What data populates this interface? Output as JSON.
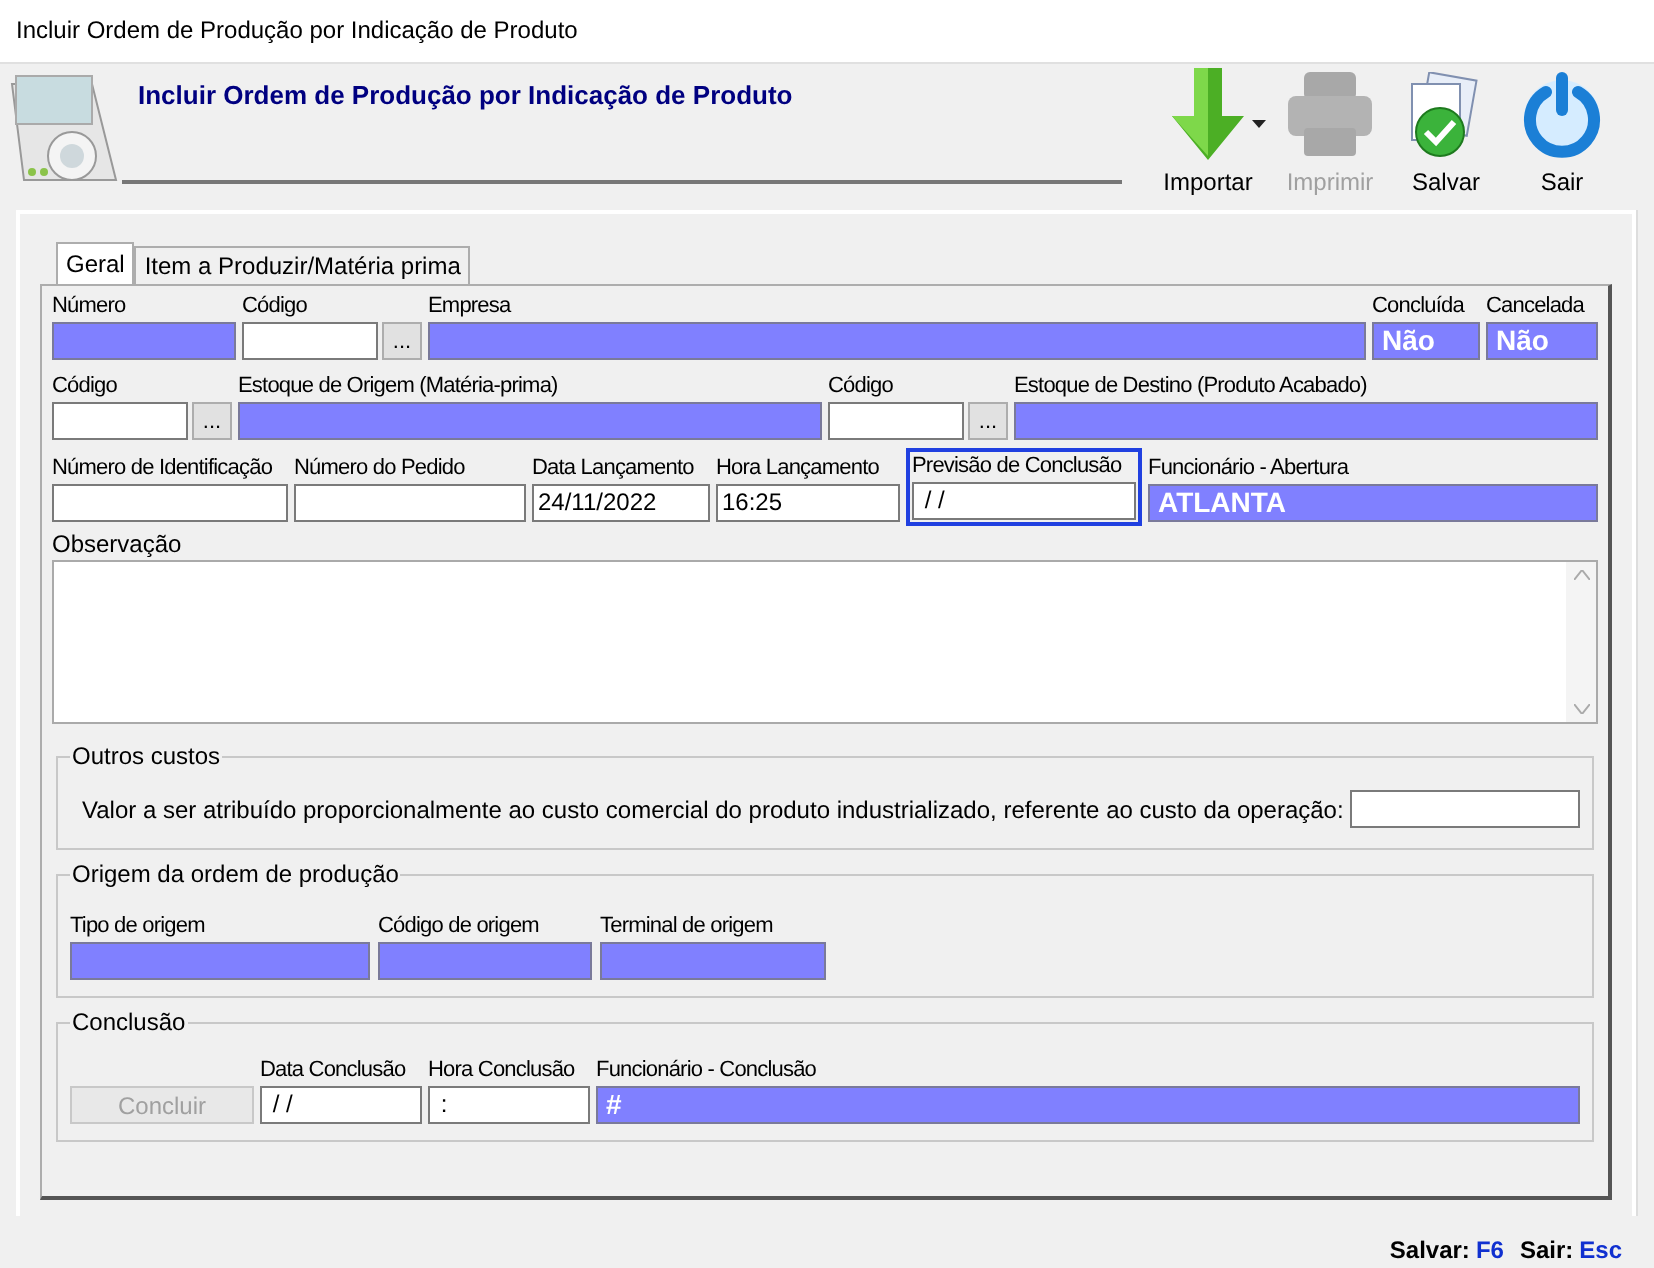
{
  "window": {
    "title": "Incluir Ordem de Produção por Indicação de Produto"
  },
  "header": {
    "title": "Incluir Ordem de Produção por Indicação de Produto"
  },
  "toolbar": [
    {
      "kind": "import",
      "label": "Importar",
      "disabled": false,
      "dropdown": true
    },
    {
      "kind": "print",
      "label": "Imprimir",
      "disabled": true,
      "dropdown": false
    },
    {
      "kind": "save",
      "label": "Salvar",
      "disabled": false,
      "dropdown": false
    },
    {
      "kind": "exit",
      "label": "Sair",
      "disabled": false,
      "dropdown": false
    }
  ],
  "tabs": [
    {
      "label": "Geral",
      "selected": true
    },
    {
      "label": "Item a Produzir/Matéria prima",
      "selected": false
    }
  ],
  "field_rows": [
    [
      {
        "label": "Número",
        "kind": "readonly"
      },
      {
        "label": "Código",
        "kind": "picker",
        "button": "..."
      },
      {
        "label": "Empresa",
        "kind": "readonly"
      },
      {
        "label": "Concluída",
        "kind": "readonly",
        "value": "Não"
      },
      {
        "label": "Cancelada",
        "kind": "readonly",
        "value": "Não"
      }
    ],
    [
      {
        "label": "Código",
        "kind": "picker",
        "button": "..."
      },
      {
        "label": "Estoque de Origem (Matéria-prima)",
        "kind": "readonly"
      },
      {
        "label": "Código",
        "kind": "picker",
        "button": "..."
      },
      {
        "label": "Estoque de Destino (Produto Acabado)",
        "kind": "readonly"
      }
    ],
    [
      {
        "label": "Número de Identificação",
        "kind": "input",
        "focused": false
      },
      {
        "label": "Número do Pedido",
        "kind": "input",
        "focused": false
      },
      {
        "label": "Data Lançamento",
        "kind": "input",
        "value": "24/11/2022",
        "focused": false
      },
      {
        "label": "Hora Lançamento",
        "kind": "input",
        "value": "16:25",
        "focused": false
      },
      {
        "label": "Previsão de Conclusão",
        "kind": "input",
        "value": " / /",
        "focused": true
      },
      {
        "label": "Funcionário - Abertura",
        "kind": "readonly",
        "value": "ATLANTA"
      }
    ]
  ],
  "observacao": {
    "label": "Observação"
  },
  "outros_custos": {
    "title": "Outros custos",
    "label": "Valor a ser atribuído proporcionalmente ao custo comercial do produto industrializado, referente ao custo da operação:"
  },
  "origem": {
    "title": "Origem da ordem de produção",
    "fields": [
      {
        "label": "Tipo de origem"
      },
      {
        "label": "Código de origem"
      },
      {
        "label": "Terminal de origem"
      }
    ]
  },
  "conclusao": {
    "title": "Conclusão",
    "button": {
      "label": "Concluir",
      "disabled": true
    },
    "fields": [
      {
        "label": "Data Conclusão",
        "kind": "input",
        "value": " / /"
      },
      {
        "label": "Hora Conclusão",
        "kind": "input",
        "value": " :"
      },
      {
        "label": "Funcionário - Conclusão",
        "kind": "readonly",
        "value": "#"
      }
    ]
  },
  "shortcuts": [
    {
      "label": "Salvar:",
      "key": "F6"
    },
    {
      "label": "Sair:",
      "key": "Esc"
    }
  ]
}
